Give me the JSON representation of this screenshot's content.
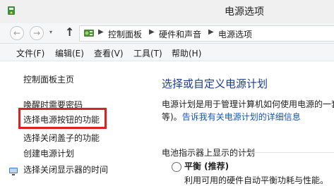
{
  "window": {
    "title": "电源选项"
  },
  "address": {
    "breadcrumbs": [
      "控制面板",
      "硬件和声音",
      "电源选项"
    ],
    "separator": "▶"
  },
  "nav": {
    "back": "←",
    "forward": "→",
    "dropdown": "▾",
    "up": "↑"
  },
  "menu": [
    "文件(F)",
    "编辑(E)",
    "查看(V)",
    "工具(T)",
    "帮助(H)"
  ],
  "sidebar": {
    "items": [
      "控制面板主页",
      "唤醒时需要密码",
      "选择电源按钮的功能",
      "选择关闭盖子的功能",
      "创建电源计划",
      "选择关闭显示器的时间"
    ]
  },
  "main": {
    "heading": "选择或自定义电源计划",
    "description_line1": "电源计划是用于管理计算机如何使用电源的一套",
    "description_line2_prefix": "等)。",
    "description_link": "告诉我有关电源计划的详细信息",
    "section_label": "电池指示器上显示的计划",
    "plan": {
      "name": "平衡 (推荐)",
      "description": "利用可用的硬件自动平衡功耗与性能。"
    }
  },
  "colors": {
    "highlight_box": "#d92323",
    "heading": "#1c3d8f",
    "link": "#1a56b3"
  }
}
